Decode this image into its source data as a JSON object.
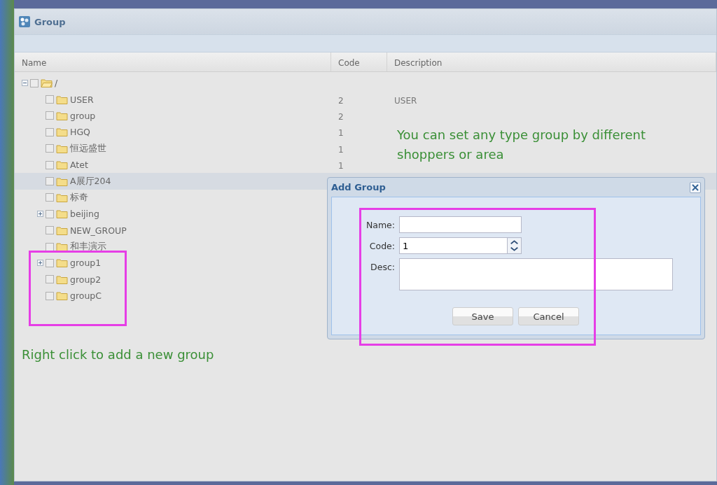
{
  "window": {
    "title": "Group"
  },
  "table": {
    "columns": [
      "Name",
      "Code",
      "Description"
    ],
    "tree": {
      "name": "/",
      "checked": false,
      "expanded": true,
      "selected": false,
      "children": [
        {
          "name": "USER",
          "checked": false,
          "selected": false,
          "code": "2",
          "description": "USER"
        },
        {
          "name": "group",
          "checked": false,
          "selected": false,
          "code": "2"
        },
        {
          "name": "HGQ",
          "checked": false,
          "selected": false,
          "code": "1"
        },
        {
          "name": "恒远盛世",
          "checked": false,
          "selected": false,
          "code": "1"
        },
        {
          "name": "Atet",
          "checked": false,
          "selected": false,
          "code": "1"
        },
        {
          "name": "A展厅204",
          "checked": false,
          "selected": true
        },
        {
          "name": "标奇",
          "checked": false,
          "selected": false
        },
        {
          "name": "beijing",
          "checked": false,
          "selected": false,
          "expanded": false
        },
        {
          "name": "NEW_GROUP",
          "checked": false,
          "selected": false
        },
        {
          "name": "和丰演示",
          "checked": false,
          "selected": false
        },
        {
          "name": "group1",
          "checked": false,
          "selected": false,
          "expanded": false
        },
        {
          "name": "group2",
          "checked": false,
          "selected": false
        },
        {
          "name": "groupC",
          "checked": false,
          "selected": false
        }
      ]
    }
  },
  "annotations": [
    {
      "text": "You can set any type group by different shoppers or area"
    },
    {
      "text": "Right click to add a new group"
    }
  ],
  "dialog": {
    "title": "Add Group",
    "fields": [
      {
        "kind": "text",
        "label": "Name:"
      },
      {
        "kind": "spinner",
        "label": "Code:",
        "value": "1"
      },
      {
        "kind": "textarea",
        "label": "Desc:"
      }
    ],
    "buttons": [
      "Save",
      "Cancel"
    ]
  }
}
